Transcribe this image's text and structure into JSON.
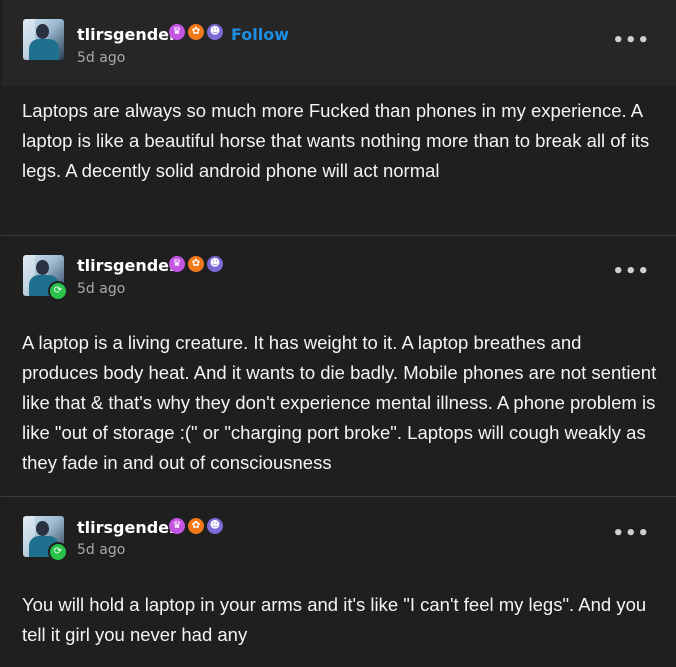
{
  "posts": [
    {
      "username": "tlirsgender",
      "follow_label": "Follow",
      "time": "5d ago",
      "badges": [
        "cupcake-badge",
        "paw-badge",
        "ghost-badge"
      ],
      "reblogged": false,
      "text": "Laptops are always so much more Fucked than phones in my experience. A laptop is like a beautiful horse that wants nothing more than to break all of its legs. A decently solid android phone will act normal"
    },
    {
      "username": "tlirsgender",
      "time": "5d ago",
      "badges": [
        "cupcake-badge",
        "paw-badge",
        "ghost-badge"
      ],
      "reblogged": true,
      "text": "A laptop is a living creature. It has weight to it. A laptop breathes and produces body heat. And it wants to die badly. Mobile phones are not sentient like that & that's why they don't experience mental illness. A phone problem is like \"out of storage :(\" or \"charging port broke\". Laptops will cough weakly as they fade in and out of consciousness"
    },
    {
      "username": "tlirsgender",
      "time": "5d ago",
      "badges": [
        "cupcake-badge",
        "paw-badge",
        "ghost-badge"
      ],
      "reblogged": true,
      "text": "You will hold a laptop in your arms and it's like \"I can't feel my legs\". And you tell it girl you never had any"
    }
  ],
  "more_label": "•••",
  "colors": {
    "background": "#1e1e1e",
    "header": "#262626",
    "follow": "#1b8fe3",
    "reblog": "#29c24b",
    "muted": "#a8a8a8"
  }
}
